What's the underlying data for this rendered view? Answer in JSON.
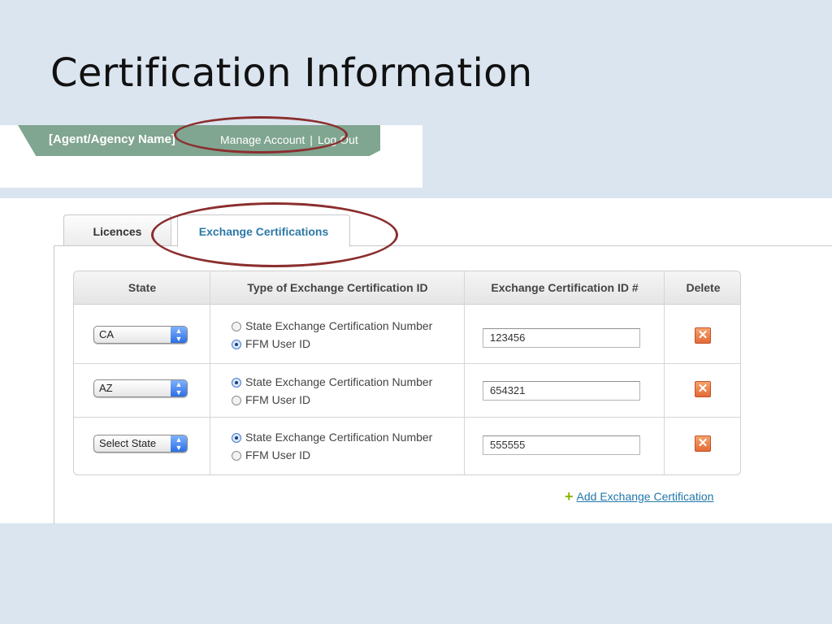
{
  "slide": {
    "title": "Certification Information"
  },
  "header": {
    "agent_name": "[Agent/Agency Name]",
    "manage_account": "Manage Account",
    "separator": "|",
    "log_out": "Log Out"
  },
  "tabs": [
    {
      "label": "Licences",
      "active": false
    },
    {
      "label": "Exchange Certifications",
      "active": true
    }
  ],
  "table": {
    "columns": [
      "State",
      "Type of Exchange Certification ID",
      "Exchange Certification ID #",
      "Delete"
    ],
    "radio_options": [
      "State Exchange Certification Number",
      "FFM User ID"
    ],
    "rows": [
      {
        "state": "CA",
        "selected_type": "FFM User ID",
        "cert_id": "123456"
      },
      {
        "state": "AZ",
        "selected_type": "State Exchange Certification Number",
        "cert_id": "654321"
      },
      {
        "state": "Select State",
        "selected_type": "State Exchange Certification Number",
        "cert_id": "555555"
      }
    ],
    "delete_glyph": "✕"
  },
  "add_action": {
    "label": "Add Exchange Certification",
    "icon": "plus-icon"
  },
  "colors": {
    "header_bar": "#80a590",
    "highlight": "#8b2e2e",
    "link": "#2277aa",
    "active_tab": "#2d79a8"
  }
}
